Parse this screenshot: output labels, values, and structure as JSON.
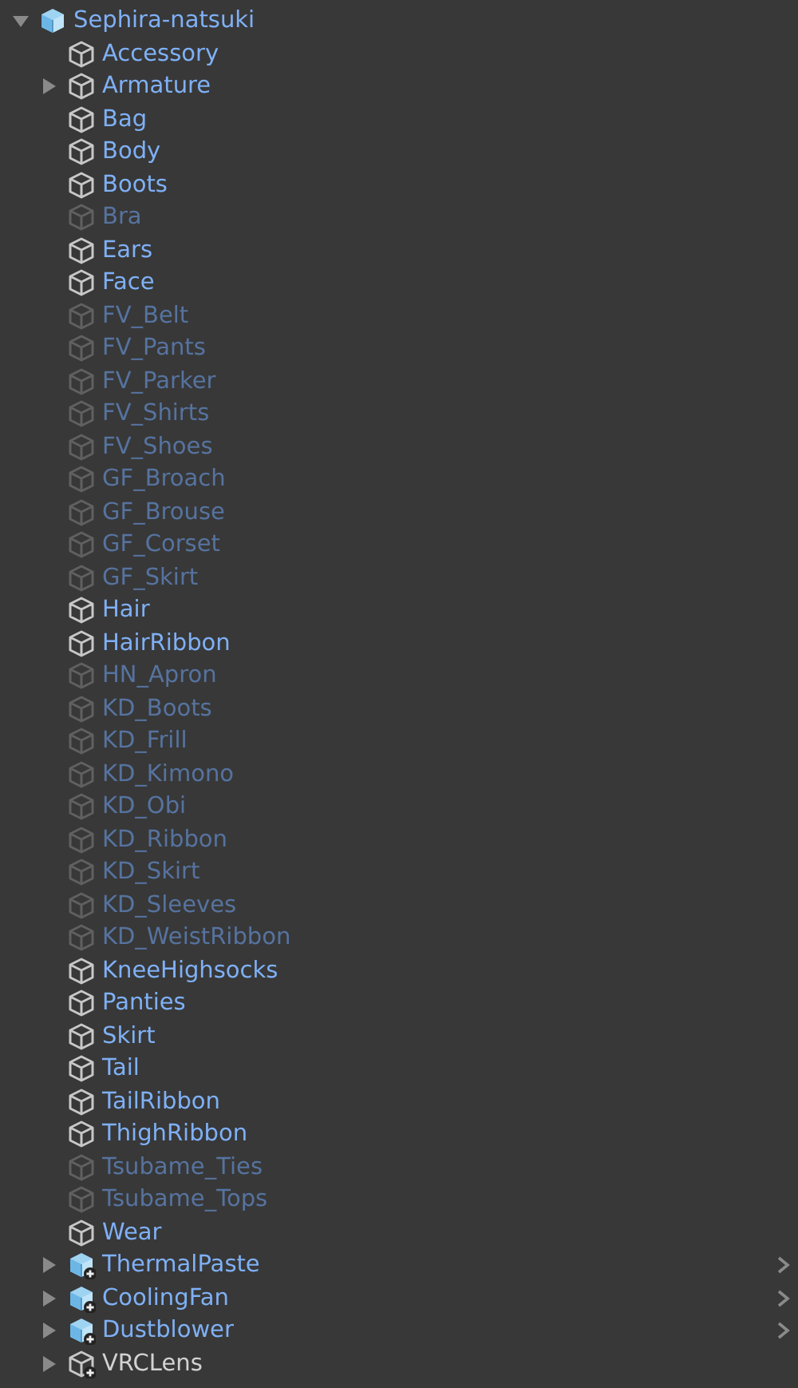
{
  "hierarchy": [
    {
      "name": "Sephira-natsuki",
      "kind": "prefab-root",
      "active": true,
      "expanded": true,
      "children": [
        {
          "name": "Accessory",
          "kind": "prefab-part",
          "active": true
        },
        {
          "name": "Armature",
          "kind": "prefab-part",
          "active": true,
          "expanded": false
        },
        {
          "name": "Bag",
          "kind": "prefab-part",
          "active": true
        },
        {
          "name": "Body",
          "kind": "prefab-part",
          "active": true
        },
        {
          "name": "Boots",
          "kind": "prefab-part",
          "active": true
        },
        {
          "name": "Bra",
          "kind": "prefab-part",
          "active": false
        },
        {
          "name": "Ears",
          "kind": "prefab-part",
          "active": true
        },
        {
          "name": "Face",
          "kind": "prefab-part",
          "active": true
        },
        {
          "name": "FV_Belt",
          "kind": "prefab-part",
          "active": false
        },
        {
          "name": "FV_Pants",
          "kind": "prefab-part",
          "active": false
        },
        {
          "name": "FV_Parker",
          "kind": "prefab-part",
          "active": false
        },
        {
          "name": "FV_Shirts",
          "kind": "prefab-part",
          "active": false
        },
        {
          "name": "FV_Shoes",
          "kind": "prefab-part",
          "active": false
        },
        {
          "name": "GF_Broach",
          "kind": "prefab-part",
          "active": false
        },
        {
          "name": "GF_Brouse",
          "kind": "prefab-part",
          "active": false
        },
        {
          "name": "GF_Corset",
          "kind": "prefab-part",
          "active": false
        },
        {
          "name": "GF_Skirt",
          "kind": "prefab-part",
          "active": false
        },
        {
          "name": "Hair",
          "kind": "prefab-part",
          "active": true
        },
        {
          "name": "HairRibbon",
          "kind": "prefab-part",
          "active": true
        },
        {
          "name": "HN_Apron",
          "kind": "prefab-part",
          "active": false
        },
        {
          "name": "KD_Boots",
          "kind": "prefab-part",
          "active": false
        },
        {
          "name": "KD_Frill",
          "kind": "prefab-part",
          "active": false
        },
        {
          "name": "KD_Kimono",
          "kind": "prefab-part",
          "active": false
        },
        {
          "name": "KD_Obi",
          "kind": "prefab-part",
          "active": false
        },
        {
          "name": "KD_Ribbon",
          "kind": "prefab-part",
          "active": false
        },
        {
          "name": "KD_Skirt",
          "kind": "prefab-part",
          "active": false
        },
        {
          "name": "KD_Sleeves",
          "kind": "prefab-part",
          "active": false
        },
        {
          "name": "KD_WeistRibbon",
          "kind": "prefab-part",
          "active": false
        },
        {
          "name": "KneeHighsocks",
          "kind": "prefab-part",
          "active": true
        },
        {
          "name": "Panties",
          "kind": "prefab-part",
          "active": true
        },
        {
          "name": "Skirt",
          "kind": "prefab-part",
          "active": true
        },
        {
          "name": "Tail",
          "kind": "prefab-part",
          "active": true
        },
        {
          "name": "TailRibbon",
          "kind": "prefab-part",
          "active": true
        },
        {
          "name": "ThighRibbon",
          "kind": "prefab-part",
          "active": true
        },
        {
          "name": "Tsubame_Ties",
          "kind": "prefab-part",
          "active": false
        },
        {
          "name": "Tsubame_Tops",
          "kind": "prefab-part",
          "active": false
        },
        {
          "name": "Wear",
          "kind": "prefab-part",
          "active": true
        },
        {
          "name": "ThermalPaste",
          "kind": "added-prefab",
          "active": true,
          "expanded": false
        },
        {
          "name": "CoolingFan",
          "kind": "added-prefab",
          "active": true,
          "expanded": false
        },
        {
          "name": "Dustblower",
          "kind": "added-prefab",
          "active": true,
          "expanded": false
        },
        {
          "name": "VRCLens",
          "kind": "added-object",
          "active": true,
          "expanded": false
        }
      ]
    }
  ]
}
